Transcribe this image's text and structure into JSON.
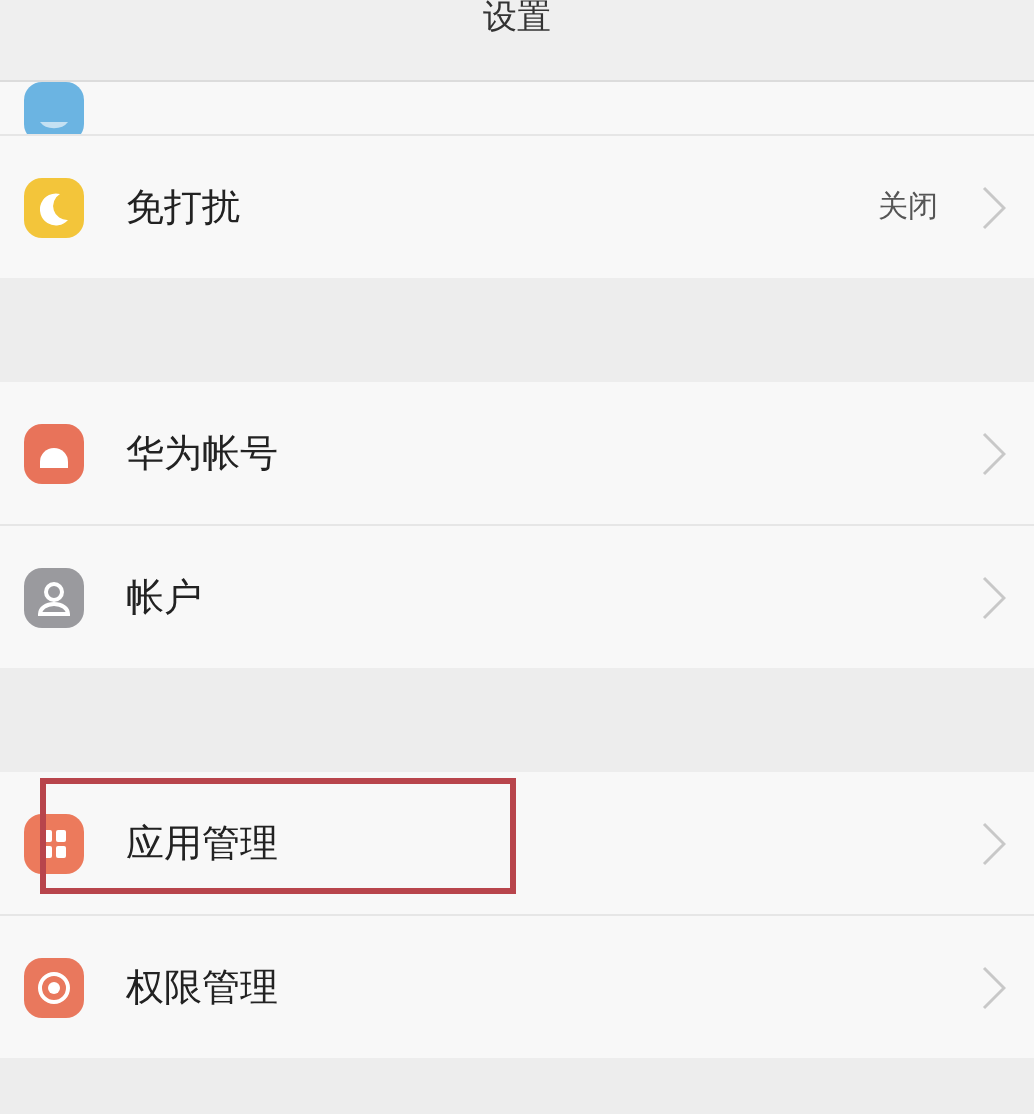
{
  "header": {
    "title": "设置"
  },
  "sections": [
    {
      "items": [
        {
          "kind": "clipped",
          "color": "#6bb4e2"
        },
        {
          "kind": "row",
          "label": "免打扰",
          "value": "关闭",
          "color": "#f3c53a",
          "highlighted": false
        }
      ]
    },
    {
      "items": [
        {
          "kind": "row",
          "label": "华为帐号",
          "color": "#e8735a",
          "highlighted": false
        },
        {
          "kind": "row",
          "label": "帐户",
          "color": "#9a9a9e",
          "highlighted": false
        }
      ]
    },
    {
      "items": [
        {
          "kind": "row",
          "label": "应用管理",
          "color": "#ec7a5c",
          "highlighted": true
        },
        {
          "kind": "row",
          "label": "权限管理",
          "color": "#e9785d",
          "highlighted": false
        }
      ]
    }
  ]
}
